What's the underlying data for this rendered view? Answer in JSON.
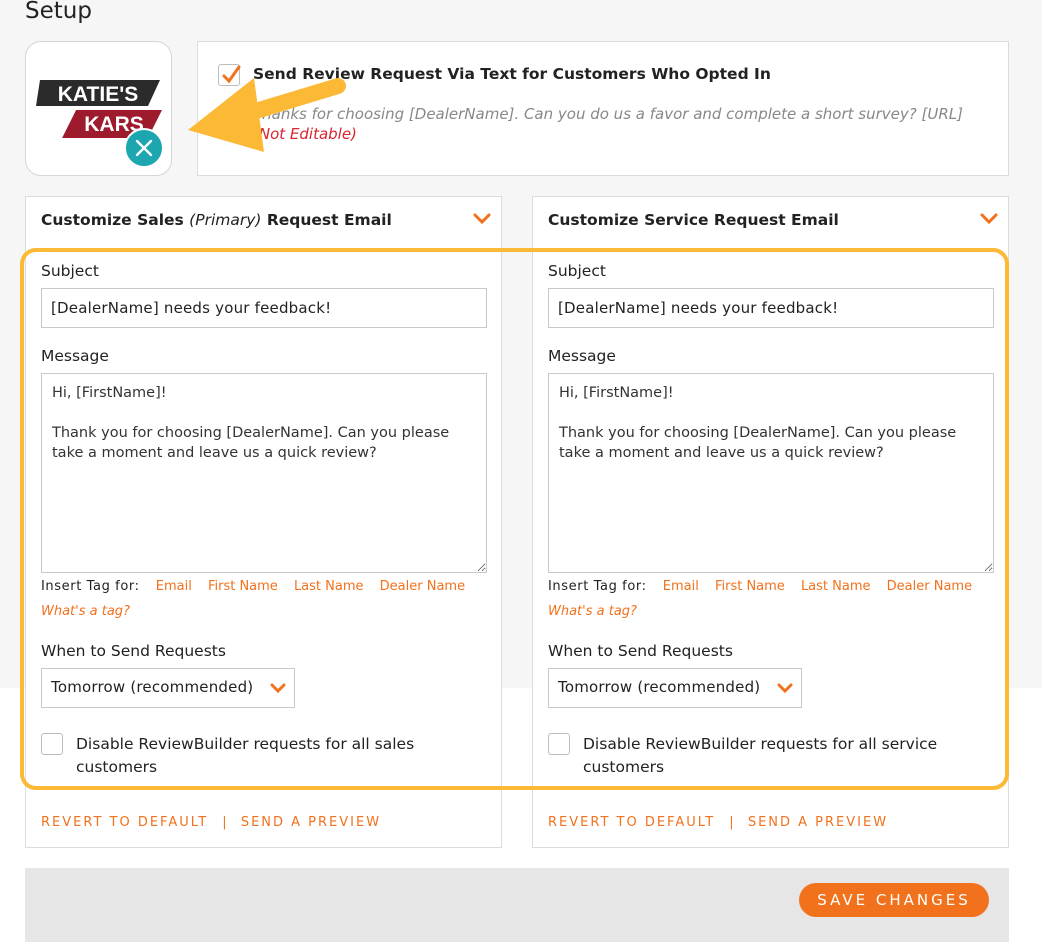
{
  "page": {
    "title": "Setup"
  },
  "logo": {
    "line1": "KATIE'S",
    "line2": "KARS",
    "remove_icon": "close-icon"
  },
  "sms": {
    "checked": true,
    "title": "Send Review Request Via Text for Customers Who Opted In",
    "message": "Thanks for choosing [DealerName]. Can you do us a favor and complete a short survey? [URL]",
    "not_editable": "(Not Editable)"
  },
  "sales": {
    "header_prefix": "Customize Sales",
    "header_primary": "(Primary)",
    "header_suffix": "Request Email",
    "subject_label": "Subject",
    "subject_value": "[DealerName] needs your feedback!",
    "message_label": "Message",
    "message_value": "Hi, [FirstName]!\n\nThank you for choosing [DealerName]. Can you please take a moment and leave us a quick review?",
    "insert_tag_label": "Insert Tag for:",
    "tags": [
      "Email",
      "First Name",
      "Last Name",
      "Dealer Name"
    ],
    "whats_tag": "What's a tag?",
    "when_label": "When to Send Requests",
    "when_value": "Tomorrow (recommended)",
    "disable_label": "Disable ReviewBuilder requests for all sales customers",
    "revert_label": "REVERT TO DEFAULT",
    "separator": "|",
    "preview_label": "SEND A PREVIEW"
  },
  "service": {
    "header": "Customize Service Request Email",
    "subject_label": "Subject",
    "subject_value": "[DealerName] needs your feedback!",
    "message_label": "Message",
    "message_value": "Hi, [FirstName]!\n\nThank you for choosing [DealerName]. Can you please take a moment and leave us a quick review?",
    "insert_tag_label": "Insert Tag for:",
    "tags": [
      "Email",
      "First Name",
      "Last Name",
      "Dealer Name"
    ],
    "whats_tag": "What's a tag?",
    "when_label": "When to Send Requests",
    "when_value": "Tomorrow (recommended)",
    "disable_label": "Disable ReviewBuilder requests for all service customers",
    "revert_label": "REVERT TO DEFAULT",
    "separator": "|",
    "preview_label": "SEND A PREVIEW"
  },
  "footer": {
    "save_label": "SAVE CHANGES"
  },
  "colors": {
    "accent": "#f2711c",
    "highlight": "#fbb935",
    "teal": "#1ba6b0",
    "not_editable": "#d9252f"
  }
}
